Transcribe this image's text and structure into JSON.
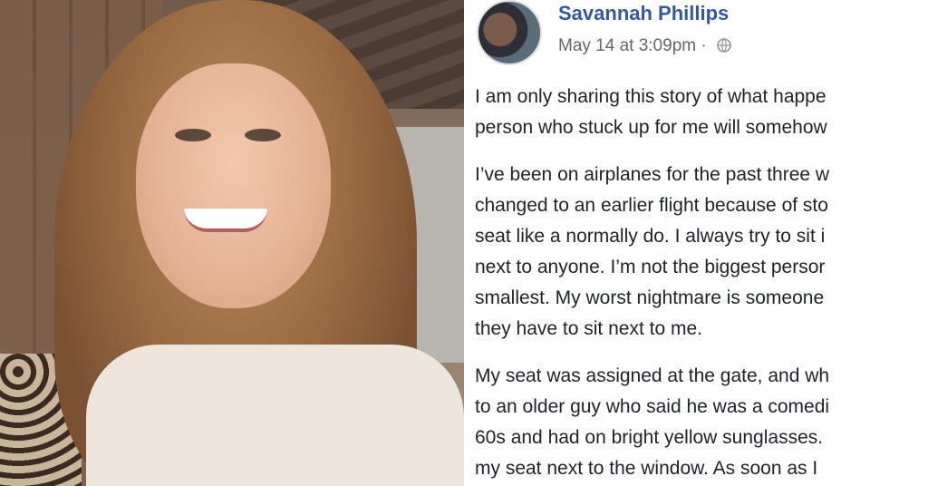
{
  "post": {
    "author": "Savannah Phillips",
    "timestamp": "May 14 at 3:09pm",
    "separator": "·",
    "privacy_icon": "globe-icon",
    "paragraphs": [
      [
        "I am only sharing this story of what happe",
        "person who stuck up for me will somehow"
      ],
      [
        "I’ve been on airplanes for the past three w",
        "changed to an earlier flight because of sto",
        "seat like a normally do. I always try to sit i",
        "next to anyone. I’m not the biggest persor",
        "smallest. My worst nightmare is someone",
        "they have to sit next to me."
      ],
      [
        "My seat was assigned at the gate, and wh",
        "to an older guy who said he was a comedi",
        "60s and had on bright yellow sunglasses.",
        "my seat next to the window. As soon as I"
      ]
    ]
  },
  "colors": {
    "author_link": "#365899",
    "meta_gray": "#616770",
    "body_text": "#1d2129"
  }
}
